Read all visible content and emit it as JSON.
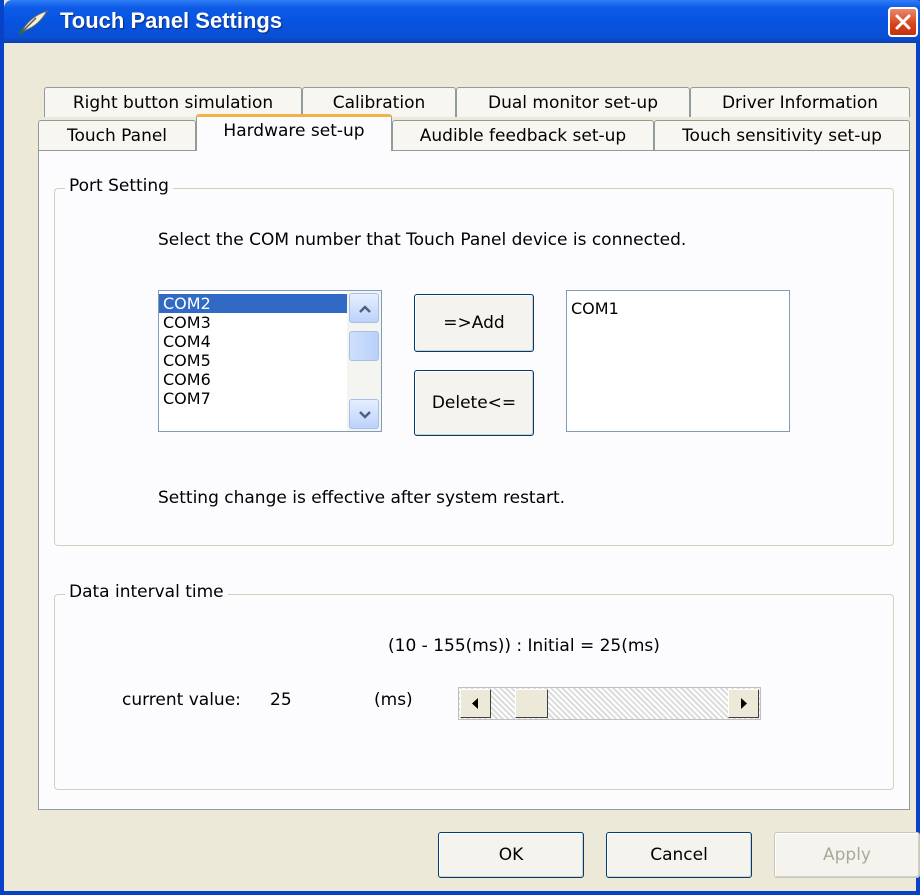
{
  "window": {
    "title": "Touch Panel Settings",
    "icon": "feather-pen-icon",
    "close_icon": "close-icon"
  },
  "tabs": {
    "row1": [
      "Right button simulation",
      "Calibration",
      "Dual monitor set-up",
      "Driver Information"
    ],
    "row2": [
      "Touch Panel",
      "Hardware set-up",
      "Audible feedback set-up",
      "Touch sensitivity set-up"
    ],
    "active": "Hardware set-up"
  },
  "port_setting": {
    "title": "Port Setting",
    "instruction": "Select the COM number that Touch Panel device is connected.",
    "available_ports": [
      "COM2",
      "COM3",
      "COM4",
      "COM5",
      "COM6",
      "COM7"
    ],
    "selected_port": "COM2",
    "add_label": "=>Add",
    "delete_label": "Delete<=",
    "connected_ports": [
      "COM1"
    ],
    "note": "Setting change is effective after system restart."
  },
  "data_interval": {
    "title": "Data interval time",
    "range_text": "(10 - 155(ms)) : Initial = 25(ms)",
    "current_label": "current value:",
    "current_value": "25",
    "unit": "(ms)",
    "min": 10,
    "max": 155,
    "value": 25
  },
  "footer": {
    "ok_label": "OK",
    "cancel_label": "Cancel",
    "apply_label": "Apply"
  },
  "colors": {
    "titlebar": "#0a56df",
    "selection": "#316ac5",
    "active_tab_accent": "#f1b24a",
    "close_button": "#d5421a"
  }
}
